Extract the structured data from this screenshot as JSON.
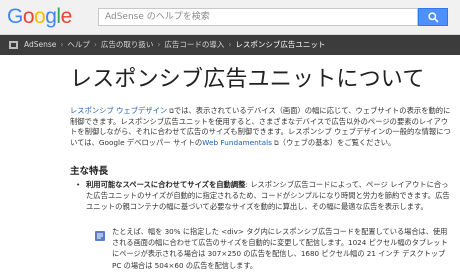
{
  "header": {
    "logo": [
      "G",
      "o",
      "o",
      "g",
      "l",
      "e"
    ],
    "search_placeholder": "AdSense のヘルプを検索"
  },
  "breadcrumb": {
    "items": [
      "AdSense",
      "ヘルプ",
      "広告の取り扱い",
      "広告コードの導入",
      "レスポンシブ広告ユニット"
    ]
  },
  "main": {
    "title": "レスポンシブ広告ユニットについて",
    "intro": {
      "link1": "レスポンシブ ウェブデザイン",
      "text1": "では、表示されているデバイス（画面）の幅に応じて、ウェブサイトの表示を動的に制御できます。レスポンシブ広告ユニットを使用すると、さまざまなデバイスで広告以外のページの要素のレイアウトを制御しながら、それに合わせて広告のサイズも制御できます。レスポンシブ ウェブデザインの一般的な情報については、Google デベロッパー サイトの",
      "link2": "Web Fundamentals",
      "text2": "（ウェブの基本）をご覧ください。"
    },
    "features_heading": "主な特長",
    "feature1": {
      "bold": "利用可能なスペースに合わせてサイズを自動調整",
      "text": ": レスポンシブ広告コードによって、ページ レイアウトに合った広告ユニットのサイズが自動的に指定されるため、コードがシンプルになり時間と労力を節約できます。広告ユニットの親コンテナの幅に基づいて必要なサイズを動的に算出し、その幅に最適な広告を表示します。"
    },
    "note": "たとえば、幅を 30% に指定した <div> タグ内にレスポンシブ広告コードを配置している場合は、使用される画面の幅に合わせて広告のサイズを自動的に変更して配信します。1024 ピクセル幅のタブレットにページが表示される場合は 307×250 の広告を配信し、1680 ピクセル幅の 21 インチ デスクトップ PC の場合は 504×60 の広告を配信します。"
  }
}
